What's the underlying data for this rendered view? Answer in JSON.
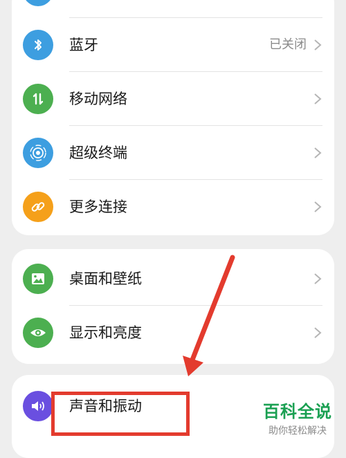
{
  "group1": {
    "items": [
      {
        "label": "",
        "icon": "wifi-icon",
        "color": "#3d9ee0"
      },
      {
        "label": "蓝牙",
        "value": "已关闭",
        "icon": "bluetooth-icon",
        "color": "#3d9ee0"
      },
      {
        "label": "移动网络",
        "icon": "mobile-data-icon",
        "color": "#4caf50"
      },
      {
        "label": "超级终端",
        "icon": "super-device-icon",
        "color": "#3d9ee0"
      },
      {
        "label": "更多连接",
        "icon": "link-icon",
        "color": "#f5a01a"
      }
    ]
  },
  "group2": {
    "items": [
      {
        "label": "桌面和壁纸",
        "icon": "image-icon",
        "color": "#4caf50"
      },
      {
        "label": "显示和亮度",
        "icon": "eye-icon",
        "color": "#4caf50"
      }
    ]
  },
  "group3": {
    "items": [
      {
        "label": "声音和振动",
        "icon": "speaker-icon",
        "color": "#6a4fe0"
      }
    ]
  },
  "watermark": {
    "title": "百科全说",
    "subtitle": "助你轻松解决"
  },
  "annotation": {
    "color": "#e33b2e"
  }
}
